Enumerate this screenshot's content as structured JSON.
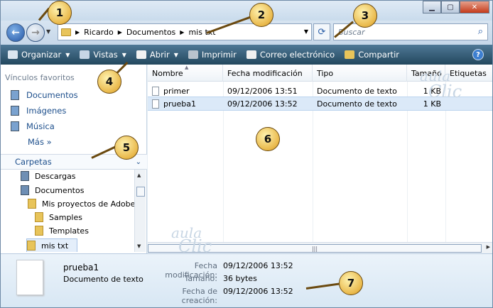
{
  "address": {
    "crumbs": [
      "Ricardo",
      "Documentos",
      "mis txt"
    ]
  },
  "search": {
    "placeholder": "Buscar"
  },
  "toolbar": {
    "organizar": "Organizar",
    "vistas": "Vistas",
    "abrir": "Abrir",
    "imprimir": "Imprimir",
    "correo": "Correo electrónico",
    "compartir": "Compartir"
  },
  "nav": {
    "favorites_header": "Vínculos favoritos",
    "favorites": [
      "Documentos",
      "Imágenes",
      "Música"
    ],
    "more": "Más",
    "folders_header": "Carpetas",
    "tree": [
      "Descargas",
      "Documentos",
      "Mis proyectos de Adobe",
      "Samples",
      "Templates",
      "mis txt"
    ]
  },
  "files": {
    "columns": [
      "Nombre",
      "Fecha modificación",
      "Tipo",
      "Tamaño",
      "Etiquetas"
    ],
    "rows": [
      {
        "name": "primer",
        "date": "09/12/2006 13:51",
        "type": "Documento de texto",
        "size": "1 KB"
      },
      {
        "name": "prueba1",
        "date": "09/12/2006 13:52",
        "type": "Documento de texto",
        "size": "1 KB"
      }
    ]
  },
  "details": {
    "name": "prueba1",
    "type": "Documento de texto",
    "mod_label": "Fecha modificación:",
    "mod_value": "09/12/2006 13:52",
    "size_label": "Tamaño:",
    "size_value": "36 bytes",
    "created_label": "Fecha de creación:",
    "created_value": "09/12/2006 13:52"
  },
  "callouts": [
    "1",
    "2",
    "3",
    "4",
    "5",
    "6",
    "7"
  ],
  "watermark": {
    "line1": "aula",
    "line2": "Clic"
  }
}
